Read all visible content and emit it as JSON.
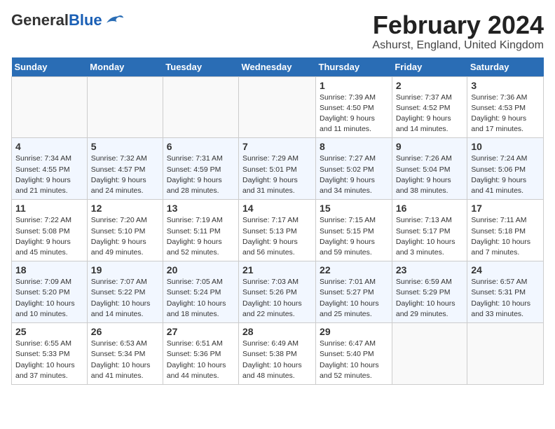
{
  "header": {
    "logo_general": "General",
    "logo_blue": "Blue",
    "month": "February 2024",
    "location": "Ashurst, England, United Kingdom"
  },
  "weekdays": [
    "Sunday",
    "Monday",
    "Tuesday",
    "Wednesday",
    "Thursday",
    "Friday",
    "Saturday"
  ],
  "weeks": [
    [
      {
        "day": "",
        "info": ""
      },
      {
        "day": "",
        "info": ""
      },
      {
        "day": "",
        "info": ""
      },
      {
        "day": "",
        "info": ""
      },
      {
        "day": "1",
        "info": "Sunrise: 7:39 AM\nSunset: 4:50 PM\nDaylight: 9 hours\nand 11 minutes."
      },
      {
        "day": "2",
        "info": "Sunrise: 7:37 AM\nSunset: 4:52 PM\nDaylight: 9 hours\nand 14 minutes."
      },
      {
        "day": "3",
        "info": "Sunrise: 7:36 AM\nSunset: 4:53 PM\nDaylight: 9 hours\nand 17 minutes."
      }
    ],
    [
      {
        "day": "4",
        "info": "Sunrise: 7:34 AM\nSunset: 4:55 PM\nDaylight: 9 hours\nand 21 minutes."
      },
      {
        "day": "5",
        "info": "Sunrise: 7:32 AM\nSunset: 4:57 PM\nDaylight: 9 hours\nand 24 minutes."
      },
      {
        "day": "6",
        "info": "Sunrise: 7:31 AM\nSunset: 4:59 PM\nDaylight: 9 hours\nand 28 minutes."
      },
      {
        "day": "7",
        "info": "Sunrise: 7:29 AM\nSunset: 5:01 PM\nDaylight: 9 hours\nand 31 minutes."
      },
      {
        "day": "8",
        "info": "Sunrise: 7:27 AM\nSunset: 5:02 PM\nDaylight: 9 hours\nand 34 minutes."
      },
      {
        "day": "9",
        "info": "Sunrise: 7:26 AM\nSunset: 5:04 PM\nDaylight: 9 hours\nand 38 minutes."
      },
      {
        "day": "10",
        "info": "Sunrise: 7:24 AM\nSunset: 5:06 PM\nDaylight: 9 hours\nand 41 minutes."
      }
    ],
    [
      {
        "day": "11",
        "info": "Sunrise: 7:22 AM\nSunset: 5:08 PM\nDaylight: 9 hours\nand 45 minutes."
      },
      {
        "day": "12",
        "info": "Sunrise: 7:20 AM\nSunset: 5:10 PM\nDaylight: 9 hours\nand 49 minutes."
      },
      {
        "day": "13",
        "info": "Sunrise: 7:19 AM\nSunset: 5:11 PM\nDaylight: 9 hours\nand 52 minutes."
      },
      {
        "day": "14",
        "info": "Sunrise: 7:17 AM\nSunset: 5:13 PM\nDaylight: 9 hours\nand 56 minutes."
      },
      {
        "day": "15",
        "info": "Sunrise: 7:15 AM\nSunset: 5:15 PM\nDaylight: 9 hours\nand 59 minutes."
      },
      {
        "day": "16",
        "info": "Sunrise: 7:13 AM\nSunset: 5:17 PM\nDaylight: 10 hours\nand 3 minutes."
      },
      {
        "day": "17",
        "info": "Sunrise: 7:11 AM\nSunset: 5:18 PM\nDaylight: 10 hours\nand 7 minutes."
      }
    ],
    [
      {
        "day": "18",
        "info": "Sunrise: 7:09 AM\nSunset: 5:20 PM\nDaylight: 10 hours\nand 10 minutes."
      },
      {
        "day": "19",
        "info": "Sunrise: 7:07 AM\nSunset: 5:22 PM\nDaylight: 10 hours\nand 14 minutes."
      },
      {
        "day": "20",
        "info": "Sunrise: 7:05 AM\nSunset: 5:24 PM\nDaylight: 10 hours\nand 18 minutes."
      },
      {
        "day": "21",
        "info": "Sunrise: 7:03 AM\nSunset: 5:26 PM\nDaylight: 10 hours\nand 22 minutes."
      },
      {
        "day": "22",
        "info": "Sunrise: 7:01 AM\nSunset: 5:27 PM\nDaylight: 10 hours\nand 25 minutes."
      },
      {
        "day": "23",
        "info": "Sunrise: 6:59 AM\nSunset: 5:29 PM\nDaylight: 10 hours\nand 29 minutes."
      },
      {
        "day": "24",
        "info": "Sunrise: 6:57 AM\nSunset: 5:31 PM\nDaylight: 10 hours\nand 33 minutes."
      }
    ],
    [
      {
        "day": "25",
        "info": "Sunrise: 6:55 AM\nSunset: 5:33 PM\nDaylight: 10 hours\nand 37 minutes."
      },
      {
        "day": "26",
        "info": "Sunrise: 6:53 AM\nSunset: 5:34 PM\nDaylight: 10 hours\nand 41 minutes."
      },
      {
        "day": "27",
        "info": "Sunrise: 6:51 AM\nSunset: 5:36 PM\nDaylight: 10 hours\nand 44 minutes."
      },
      {
        "day": "28",
        "info": "Sunrise: 6:49 AM\nSunset: 5:38 PM\nDaylight: 10 hours\nand 48 minutes."
      },
      {
        "day": "29",
        "info": "Sunrise: 6:47 AM\nSunset: 5:40 PM\nDaylight: 10 hours\nand 52 minutes."
      },
      {
        "day": "",
        "info": ""
      },
      {
        "day": "",
        "info": ""
      }
    ]
  ]
}
